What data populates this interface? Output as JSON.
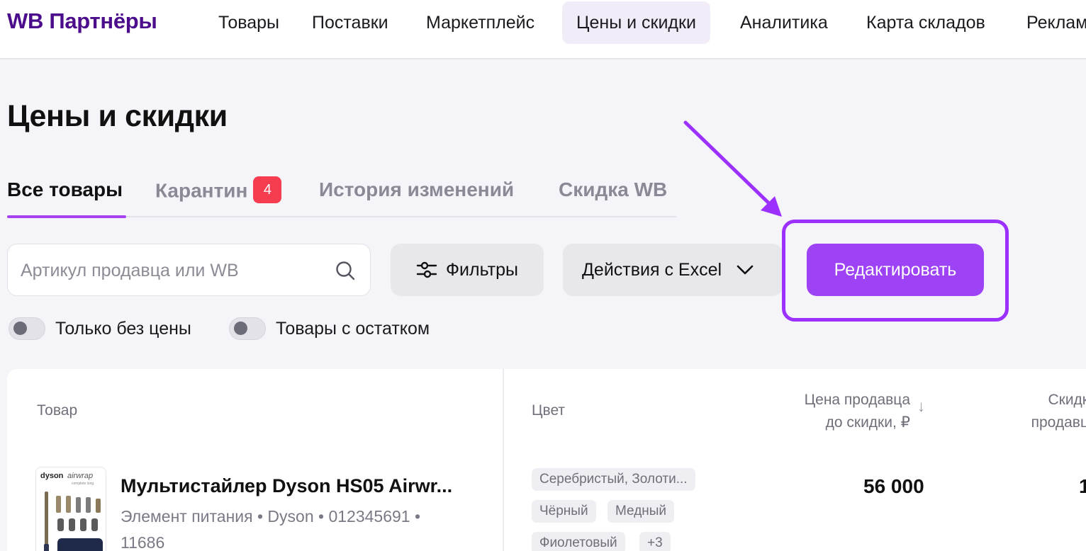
{
  "brand": "WB Партнёры",
  "nav": {
    "items": [
      {
        "label": "Товары"
      },
      {
        "label": "Поставки"
      },
      {
        "label": "Маркетплейс"
      },
      {
        "label": "Цены и скидки",
        "active": true
      },
      {
        "label": "Аналитика"
      },
      {
        "label": "Карта складов"
      },
      {
        "label": "Реклам"
      }
    ]
  },
  "page": {
    "title": "Цены и скидки"
  },
  "tabs": [
    {
      "label": "Все товары",
      "active": true
    },
    {
      "label": "Карантин",
      "badge": "4"
    },
    {
      "label": "История изменений"
    },
    {
      "label": "Скидка WB"
    }
  ],
  "toolbar": {
    "search_placeholder": "Артикул продавца или WB",
    "search_value": "",
    "filters_label": "Фильтры",
    "excel_label": "Действия с Excel",
    "edit_label": "Редактировать"
  },
  "toggles": [
    {
      "label": "Только без цены",
      "on": false
    },
    {
      "label": "Товары с остатком",
      "on": false
    }
  ],
  "table": {
    "columns": {
      "product": "Товар",
      "color": "Цвет",
      "price_line1": "Цена продавца",
      "price_line2": "до скидки, ₽",
      "discount_line1": "Скидк",
      "discount_line2": "продавц"
    },
    "rows": [
      {
        "thumb_brand": "dyson",
        "thumb_model": "airwrap",
        "thumb_sub": "complete long",
        "name": "Мультистайлер Dyson HS05 Airwr...",
        "meta": "Элемент питания • Dyson • 012345691 • 11686",
        "colors": [
          "Серебристый, Золоти...",
          "Чёрный",
          "Медный",
          "Фиолетовый",
          "+3"
        ],
        "price": "56 000",
        "discount_cut": "1"
      }
    ]
  },
  "colors": {
    "brand": "#4b0d8c",
    "accent": "#9d42f5",
    "highlight": "#9b30ff",
    "badge": "#f53d4f"
  }
}
